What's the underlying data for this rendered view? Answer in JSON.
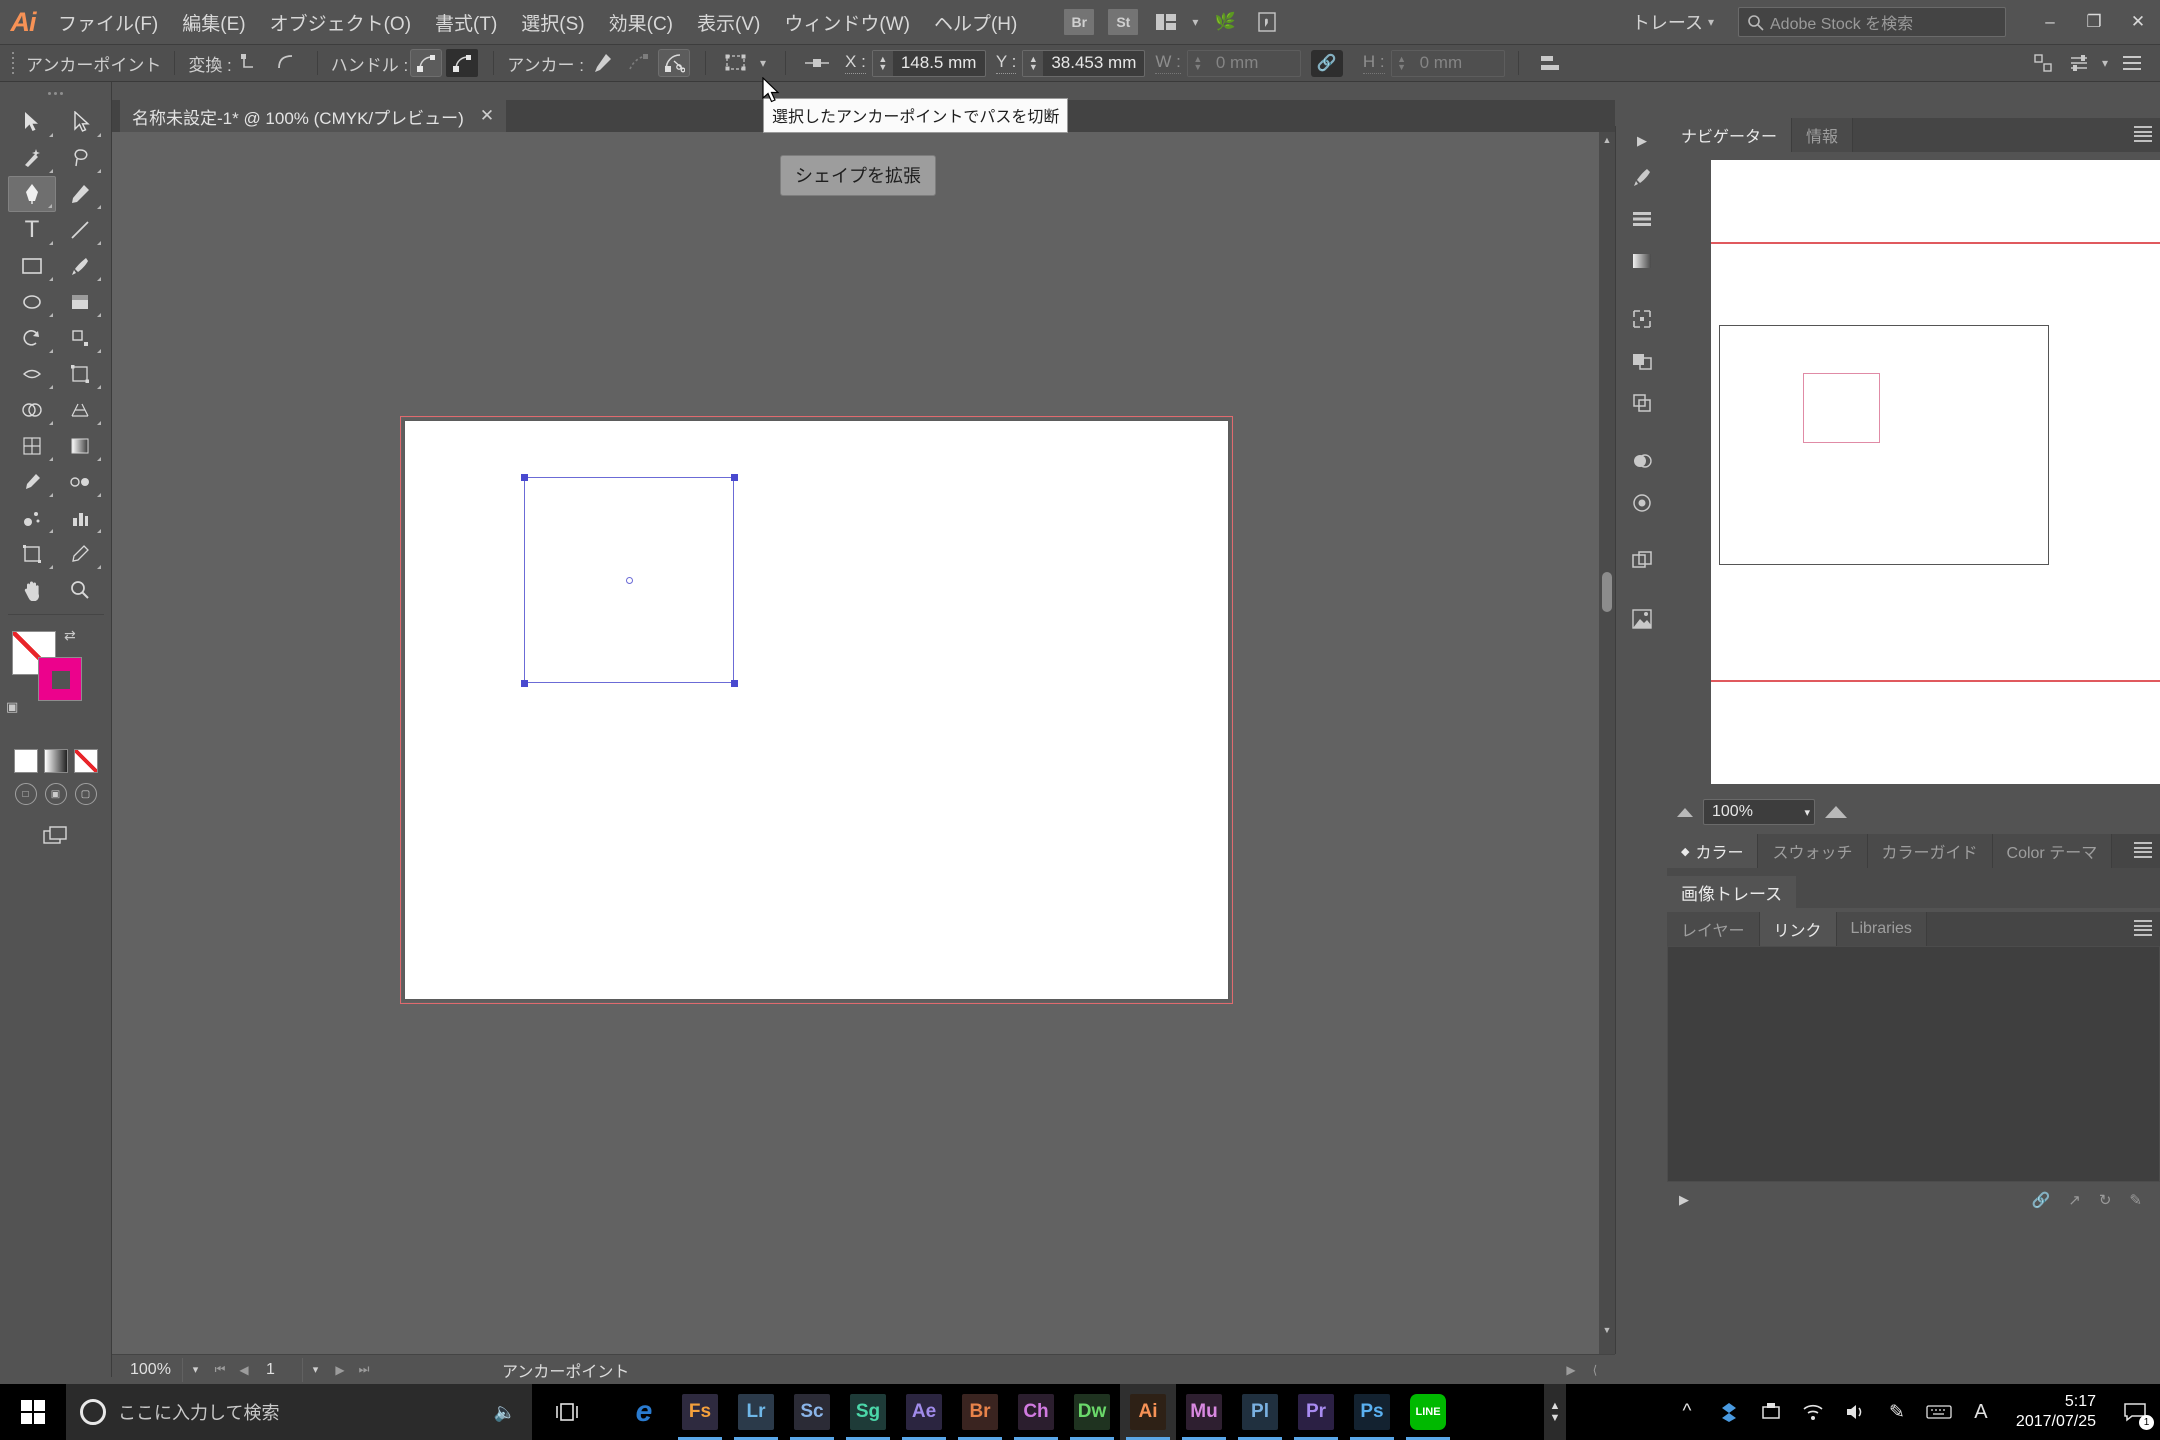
{
  "app": {
    "logo": "Ai",
    "menus": [
      {
        "label": "ファイル(F)"
      },
      {
        "label": "編集(E)"
      },
      {
        "label": "オブジェクト(O)"
      },
      {
        "label": "書式(T)"
      },
      {
        "label": "選択(S)"
      },
      {
        "label": "効果(C)"
      },
      {
        "label": "表示(V)"
      },
      {
        "label": "ウィンドウ(W)"
      },
      {
        "label": "ヘルプ(H)"
      }
    ],
    "bridge_button": "Br",
    "stock_button": "St",
    "arrange_icon": "arrange-documents-icon",
    "workspace": "トレース",
    "search_placeholder": "Adobe Stock を検索",
    "window_buttons": {
      "minimize": "–",
      "restore": "❐",
      "close": "✕"
    }
  },
  "control_bar": {
    "selection_label": "アンカーポイント",
    "transform_label": "変換 :",
    "handle_label": "ハンドル :",
    "anchor_label": "アンカー :",
    "x_label": "X :",
    "x_value": "148.5 mm",
    "y_label": "Y :",
    "y_value": "38.453 mm",
    "w_label": "W :",
    "w_value": "0 mm",
    "h_label": "H :",
    "h_value": "0 mm",
    "link_icon": "link-chain-icon",
    "align_icon": "align-icon",
    "preferences_icon": "preferences-icon",
    "menu_icon": "panel-menu-icon"
  },
  "tooltip": {
    "text": "選択したアンカーポイントでパスを切断"
  },
  "document": {
    "tab_title": "名称未設定-1* @ 100% (CMYK/プレビュー)",
    "tab_close": "✕",
    "shape_button": "シェイプを拡張"
  },
  "toolbar": {
    "tools": [
      {
        "name": "selection-tool",
        "glyph": "➤"
      },
      {
        "name": "direct-selection-tool",
        "glyph": "➤"
      },
      {
        "name": "magic-wand-tool",
        "glyph": "✦"
      },
      {
        "name": "lasso-tool",
        "glyph": "⤵"
      },
      {
        "name": "pen-tool",
        "glyph": "✒"
      },
      {
        "name": "add-anchor-point-tool",
        "glyph": "✎"
      },
      {
        "name": "type-tool",
        "glyph": "T"
      },
      {
        "name": "line-segment-tool",
        "glyph": "╱"
      },
      {
        "name": "rectangle-tool",
        "glyph": "▭"
      },
      {
        "name": "paintbrush-tool",
        "glyph": "✐"
      },
      {
        "name": "shaper-tool",
        "glyph": "◔"
      },
      {
        "name": "eraser-tool",
        "glyph": "◧"
      },
      {
        "name": "rotate-tool",
        "glyph": "↺"
      },
      {
        "name": "scale-tool",
        "glyph": "⤡"
      },
      {
        "name": "width-tool",
        "glyph": "⤳"
      },
      {
        "name": "free-transform-tool",
        "glyph": "⬚"
      },
      {
        "name": "shape-builder-tool",
        "glyph": "◑"
      },
      {
        "name": "perspective-grid-tool",
        "glyph": "◱"
      },
      {
        "name": "mesh-tool",
        "glyph": "⊞"
      },
      {
        "name": "gradient-tool",
        "glyph": "◫"
      },
      {
        "name": "eyedropper-tool",
        "glyph": "⚗"
      },
      {
        "name": "blend-tool",
        "glyph": "⚶"
      },
      {
        "name": "symbol-sprayer-tool",
        "glyph": "☂"
      },
      {
        "name": "column-graph-tool",
        "glyph": "▐"
      },
      {
        "name": "artboard-tool",
        "glyph": "⬜"
      },
      {
        "name": "slice-tool",
        "glyph": "✂"
      },
      {
        "name": "hand-tool",
        "glyph": "✋"
      },
      {
        "name": "zoom-tool",
        "glyph": "⌕"
      }
    ],
    "fill_label": "fill-swatch",
    "stroke_label": "stroke-swatch",
    "swap_icon": "swap-fill-stroke-icon",
    "default_icon": "default-fill-stroke-icon",
    "color_mode_icons": [
      "color-swatch",
      "gradient-swatch",
      "none-swatch"
    ],
    "screen_mode_icons": [
      "draw-normal-icon",
      "draw-behind-icon",
      "draw-inside-icon"
    ],
    "screen_mode": "change-screen-mode-icon"
  },
  "statusbar": {
    "zoom": "100%",
    "page": "1",
    "status_text": "アンカーポイント",
    "first_icon": "⏮",
    "prev_icon": "◀",
    "next_icon": "▶",
    "last_icon": "⏭"
  },
  "right_rail": {
    "items": [
      {
        "name": "expand-panels-icon",
        "glyph": "▶"
      },
      {
        "name": "brushes-panel-icon",
        "glyph": "✎"
      },
      {
        "name": "align-panel-icon",
        "glyph": "☰"
      },
      {
        "name": "gradient-panel-icon",
        "glyph": "▤"
      },
      {
        "name": "transform-panel-icon",
        "glyph": "⌗"
      },
      {
        "name": "pathfinder-panel-icon",
        "glyph": "◫"
      },
      {
        "name": "layers-panel-icon",
        "glyph": "❑"
      },
      {
        "name": "appearance-panel-icon",
        "glyph": "●"
      },
      {
        "name": "graphic-styles-panel-icon",
        "glyph": "◎"
      },
      {
        "name": "artboards-panel-icon",
        "glyph": "⧉"
      },
      {
        "name": "symbols-panel-icon",
        "glyph": "◩"
      }
    ]
  },
  "navigator_panel": {
    "tabs": [
      {
        "label": "ナビゲーター",
        "active": true
      },
      {
        "label": "情報",
        "active": false
      }
    ],
    "zoom_value": "100%"
  },
  "color_panel": {
    "tabs": [
      {
        "label": "カラー",
        "active": true
      },
      {
        "label": "スウォッチ",
        "active": false
      },
      {
        "label": "カラーガイド",
        "active": false
      },
      {
        "label": "Color テーマ",
        "active": false
      }
    ]
  },
  "trace_panel": {
    "tab": "画像トレース"
  },
  "links_panel": {
    "tabs": [
      {
        "label": "レイヤー",
        "active": false
      },
      {
        "label": "リンク",
        "active": true
      },
      {
        "label": "Libraries",
        "active": false
      }
    ]
  },
  "taskbar": {
    "search_placeholder": "ここに入力して検索",
    "apps": [
      {
        "name": "edge",
        "label": "e",
        "color": "#2a7bd0",
        "text": "#ffffff",
        "plain": true
      },
      {
        "name": "fuse",
        "label": "Fs",
        "color": "#2e2a3f",
        "text": "#f5a03c"
      },
      {
        "name": "lightroom",
        "label": "Lr",
        "color": "#2b3a4a",
        "text": "#6fb7e8"
      },
      {
        "name": "scout",
        "label": "Sc",
        "color": "#2b2b36",
        "text": "#8ab4e8"
      },
      {
        "name": "stock",
        "label": "Sg",
        "color": "#1e3b38",
        "text": "#4bd6a8"
      },
      {
        "name": "after-effects",
        "label": "Ae",
        "color": "#2b2540",
        "text": "#a08bea"
      },
      {
        "name": "bridge",
        "label": "Br",
        "color": "#3a2420",
        "text": "#e8834a"
      },
      {
        "name": "character-animator",
        "label": "Ch",
        "color": "#2b1e2e",
        "text": "#d07ae0"
      },
      {
        "name": "dreamweaver",
        "label": "Dw",
        "color": "#1f3320",
        "text": "#6ad86a"
      },
      {
        "name": "illustrator",
        "label": "Ai",
        "color": "#2e2116",
        "text": "#f79256",
        "active": true
      },
      {
        "name": "muse",
        "label": "Mu",
        "color": "#2e1f30",
        "text": "#d888e0"
      },
      {
        "name": "prelude",
        "label": "Pl",
        "color": "#20303f",
        "text": "#7ab0e0"
      },
      {
        "name": "premiere",
        "label": "Pr",
        "color": "#2b2044",
        "text": "#a88bf0"
      },
      {
        "name": "photoshop",
        "label": "Ps",
        "color": "#132230",
        "text": "#5ab0f0"
      },
      {
        "name": "line",
        "label": "LINE",
        "color": "#00b900",
        "text": "#ffffff"
      }
    ],
    "tray": [
      {
        "name": "show-hidden-icons",
        "glyph": "∧"
      },
      {
        "name": "dropbox-icon",
        "glyph": "❖"
      },
      {
        "name": "removable-media-icon",
        "glyph": "⌷"
      },
      {
        "name": "network-icon",
        "glyph": "◠"
      },
      {
        "name": "volume-icon",
        "glyph": "🔊"
      },
      {
        "name": "pen-settings-icon",
        "glyph": "✎"
      },
      {
        "name": "keyboard-icon",
        "glyph": "⌨"
      },
      {
        "name": "ime-icon",
        "glyph": "A"
      }
    ],
    "time": "5:17",
    "date": "2017/07/25",
    "notification_count": "1"
  }
}
